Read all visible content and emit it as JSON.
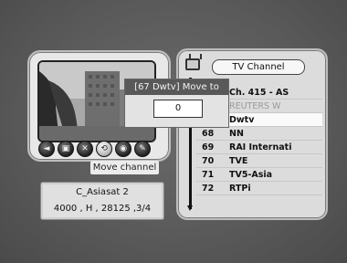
{
  "preview": {
    "icons": [
      {
        "name": "prev-icon",
        "glyph": "◄"
      },
      {
        "name": "lock-icon",
        "glyph": "▣"
      },
      {
        "name": "skip-icon",
        "glyph": "✕"
      },
      {
        "name": "move-icon",
        "glyph": "⟲"
      },
      {
        "name": "sort-icon",
        "glyph": "◉"
      },
      {
        "name": "edit-icon",
        "glyph": "✎"
      }
    ],
    "selected_icon_index": 3,
    "tooltip": "Move channel"
  },
  "satellite": {
    "name": "C_Asiasat 2",
    "params": "4000 , H , 28125 ,3/4"
  },
  "channel_panel": {
    "title": "TV Channel",
    "header": "Ch. 415 - AS",
    "rows": [
      {
        "num": "",
        "name": "REUTERS W",
        "style": "dim"
      },
      {
        "num": "",
        "name": "Dwtv",
        "style": "highlight"
      },
      {
        "num": "68",
        "name": "NN",
        "style": "normal"
      },
      {
        "num": "69",
        "name": "RAI Internati",
        "style": "normal"
      },
      {
        "num": "70",
        "name": "TVE",
        "style": "normal"
      },
      {
        "num": "71",
        "name": "TV5-Asia",
        "style": "normal"
      },
      {
        "num": "72",
        "name": "RTPi",
        "style": "normal"
      }
    ]
  },
  "move_dialog": {
    "title": "[67 Dwtv] Move to",
    "value": "0"
  }
}
